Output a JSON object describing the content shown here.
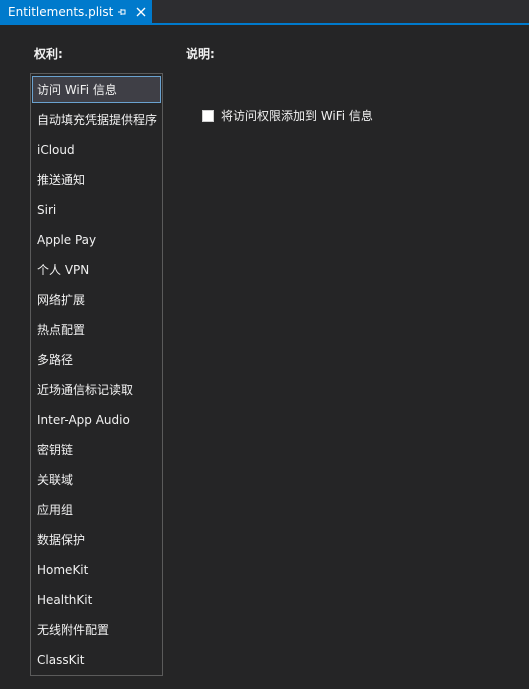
{
  "tab": {
    "title": "Entitlements.plist",
    "pin_icon": "pin-icon",
    "close_icon": "close-icon"
  },
  "headers": {
    "entitlements": "权利:",
    "description": "说明:"
  },
  "entitlements": [
    {
      "label": "访问 WiFi 信息",
      "selected": true
    },
    {
      "label": "自动填充凭据提供程序"
    },
    {
      "label": "iCloud"
    },
    {
      "label": "推送通知"
    },
    {
      "label": "Siri"
    },
    {
      "label": "Apple Pay"
    },
    {
      "label": "个人 VPN"
    },
    {
      "label": "网络扩展"
    },
    {
      "label": "热点配置"
    },
    {
      "label": "多路径"
    },
    {
      "label": "近场通信标记读取"
    },
    {
      "label": "Inter-App Audio"
    },
    {
      "label": "密钥链"
    },
    {
      "label": "关联域"
    },
    {
      "label": "应用组"
    },
    {
      "label": "数据保护"
    },
    {
      "label": "HomeKit"
    },
    {
      "label": "HealthKit"
    },
    {
      "label": "无线附件配置"
    },
    {
      "label": "ClassKit"
    }
  ],
  "detail": {
    "checkbox_label": "将访问权限添加到 WiFi 信息",
    "checked": false
  },
  "colors": {
    "accent": "#007acc",
    "background": "#252526",
    "selection_border": "#6aa2cf"
  }
}
